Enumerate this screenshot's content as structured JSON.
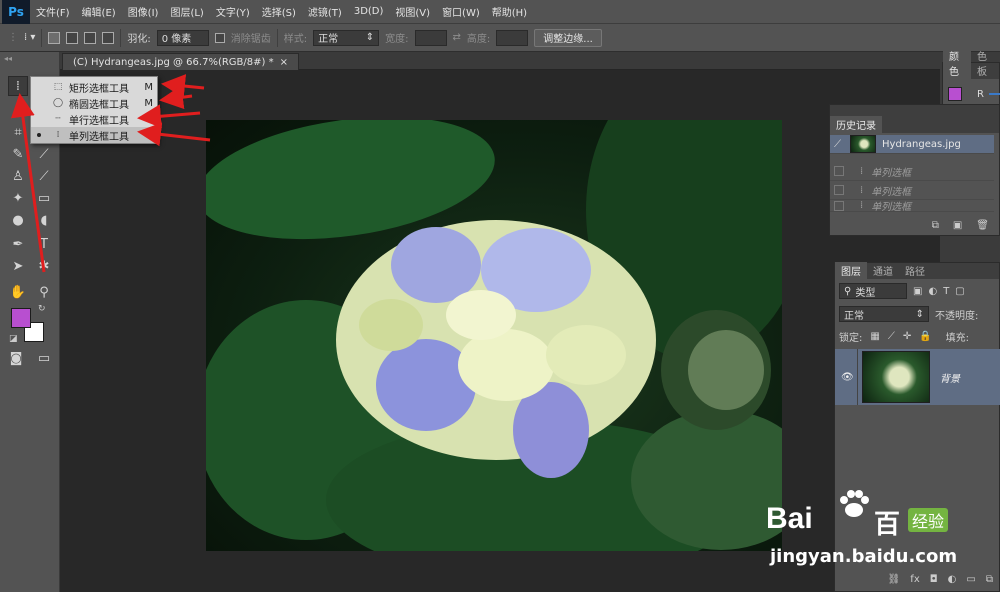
{
  "app": {
    "logo": "Ps"
  },
  "menu": [
    "文件(F)",
    "编辑(E)",
    "图像(I)",
    "图层(L)",
    "文字(Y)",
    "选择(S)",
    "滤镜(T)",
    "3D(D)",
    "视图(V)",
    "窗口(W)",
    "帮助(H)"
  ],
  "options": {
    "feather_label": "羽化:",
    "feather_value": "0 像素",
    "antialias_label": "消除锯齿",
    "style_label": "样式:",
    "style_value": "正常",
    "width_label": "宽度:",
    "height_label": "高度:",
    "refine_button": "调整边缘..."
  },
  "document": {
    "tab_title": "(C) Hydrangeas.jpg @ 66.7%(RGB/8#) *",
    "close": "×"
  },
  "flyout": [
    {
      "label": "矩形选框工具",
      "key": "M",
      "icon": "rect-marquee-icon"
    },
    {
      "label": "椭圆选框工具",
      "key": "M",
      "icon": "ellipse-marquee-icon"
    },
    {
      "label": "单行选框工具",
      "key": "",
      "icon": "row-marquee-icon"
    },
    {
      "label": "单列选框工具",
      "key": "",
      "icon": "column-marquee-icon",
      "selected": true
    }
  ],
  "colors": {
    "foreground": "#b84fd0",
    "background": "#ffffff",
    "annotation_arrow": "#e01e1e"
  },
  "color_panel": {
    "tabs": [
      "颜色",
      "色板"
    ],
    "channel": "R"
  },
  "history": {
    "title": "历史记录",
    "snapshot": "Hydrangeas.jpg",
    "states": [
      "单列选框",
      "单列选框",
      "单列选框"
    ]
  },
  "layers": {
    "tabs": [
      "图层",
      "通道",
      "路径"
    ],
    "filter": "类型",
    "blend": "正常",
    "opacity_label": "不透明度:",
    "lock_label": "锁定:",
    "fill_label": "填充:",
    "layer_name": "背景"
  },
  "watermark": {
    "brand": "Bai",
    "brand2": "百",
    "badge": "经验",
    "url": "jingyan.baidu.com"
  }
}
